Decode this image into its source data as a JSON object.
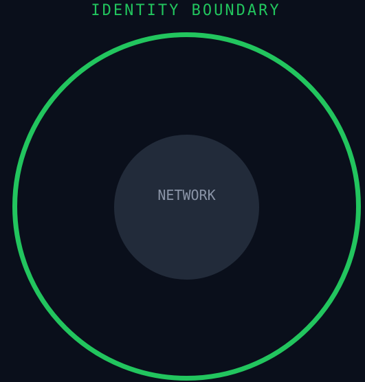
{
  "diagram": {
    "outer_label": "IDENTITY BOUNDARY",
    "inner_label": "NETWORK"
  },
  "colors": {
    "background": "#0a0f1b",
    "boundary_accent": "#22c55e",
    "core_fill": "#222b3a",
    "core_text": "#8a94a7"
  }
}
